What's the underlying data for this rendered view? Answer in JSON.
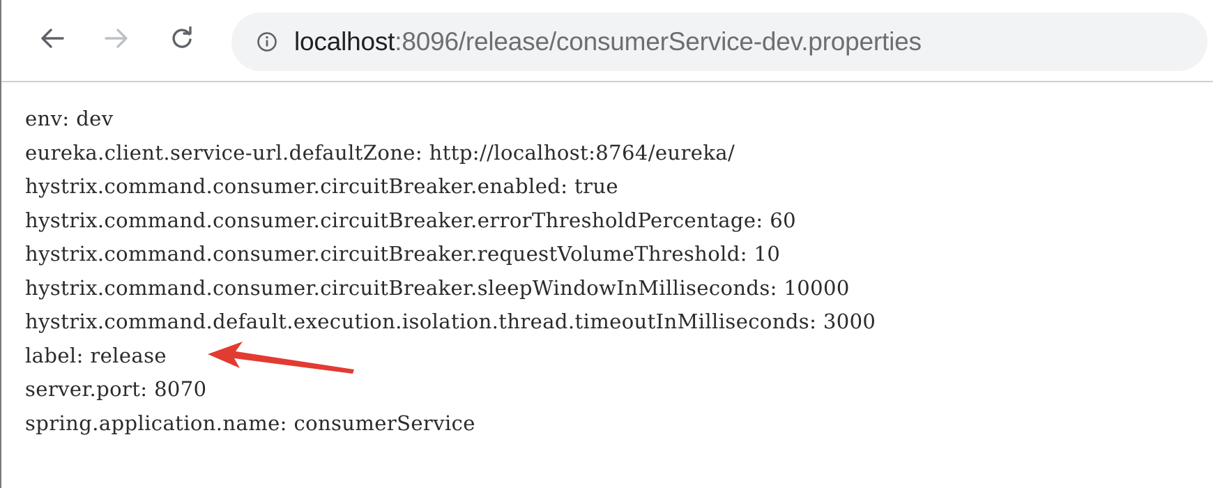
{
  "browser": {
    "url_host": "localhost",
    "url_rest": ":8096/release/consumerService-dev.properties",
    "icons": {
      "back": "arrow-left",
      "forward": "arrow-right",
      "reload": "reload",
      "site_info": "info-circle"
    },
    "colors": {
      "omnibox_bg": "#f1f3f4",
      "annotation_arrow": "#e23b32"
    }
  },
  "properties": {
    "lines": [
      "env: dev",
      "eureka.client.service-url.defaultZone: http://localhost:8764/eureka/",
      "hystrix.command.consumer.circuitBreaker.enabled: true",
      "hystrix.command.consumer.circuitBreaker.errorThresholdPercentage: 60",
      "hystrix.command.consumer.circuitBreaker.requestVolumeThreshold: 10",
      "hystrix.command.consumer.circuitBreaker.sleepWindowInMilliseconds: 10000",
      "hystrix.command.default.execution.isolation.thread.timeoutInMilliseconds: 3000",
      "label: release",
      "server.port: 8070",
      "spring.application.name: consumerService"
    ]
  }
}
